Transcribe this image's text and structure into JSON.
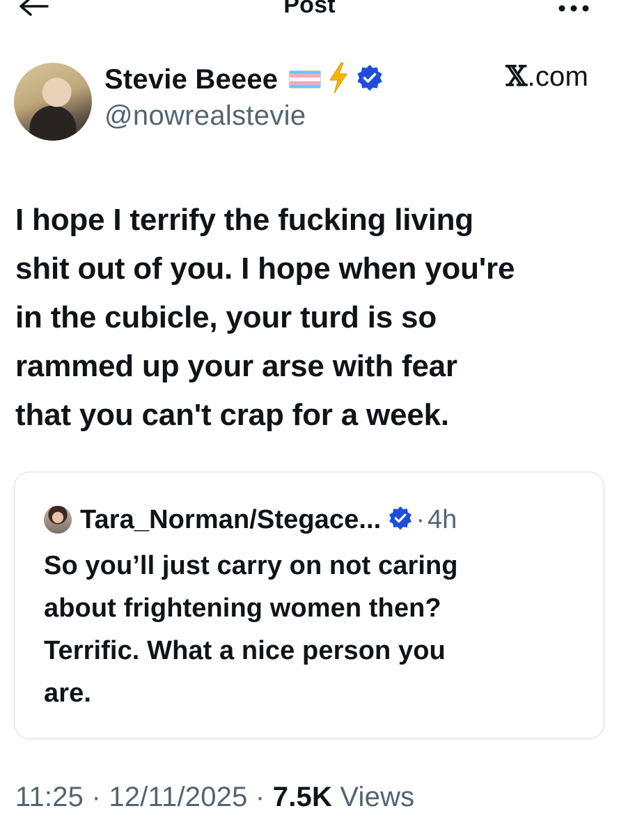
{
  "topbar": {
    "title": "Post",
    "back_icon": "arrow-left-icon",
    "more_icon": "more-horizontal-icon"
  },
  "author": {
    "display_name": "Stevie Beeee",
    "handle": "@nowrealstevie",
    "badges": [
      "transgender-flag-icon",
      "lightning-icon",
      "verified-badge-icon"
    ],
    "verified_color": "#1d4ed8"
  },
  "source": {
    "mark": "𝕏",
    "label": ".com"
  },
  "tweet": {
    "lines": [
      "I hope I terrify the fucking living",
      "shit out of you. I hope when you're",
      "in the cubicle, your turd is so",
      "rammed up your arse with fear",
      "that you can't crap for a week."
    ]
  },
  "quote": {
    "name": "Tara_Norman/Stegace...",
    "separator": "·",
    "time": "4h",
    "lines": [
      "So you’ll just carry on not caring",
      "about frightening women then?",
      "Terrific. What a nice person you",
      "are."
    ]
  },
  "meta": {
    "time": "11:25",
    "date": "12/11/2025",
    "views_count": "7.5K",
    "views_label": "Views",
    "separator": "·"
  },
  "colors": {
    "text": "#0f1419",
    "muted": "#536471",
    "border": "#d6dce1",
    "verified": "#1d4ed8",
    "bolt": "#f5b400"
  }
}
